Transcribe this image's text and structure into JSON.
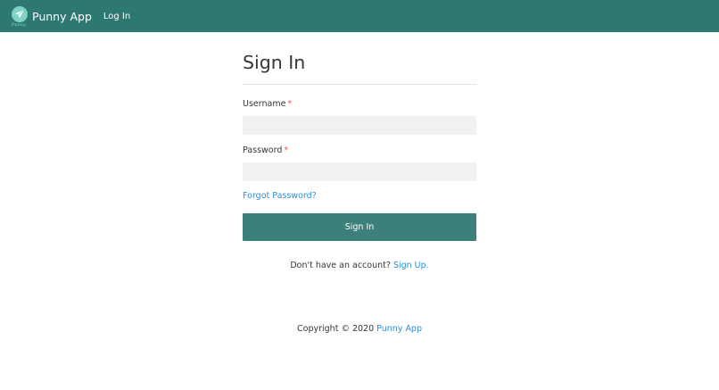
{
  "navbar": {
    "brand_name": "Punny App",
    "logo_script_text": "Punny",
    "login_link": "Log In",
    "logo_icon": "paper-plane-icon"
  },
  "form": {
    "title": "Sign In",
    "username_label": "Username",
    "password_label": "Password",
    "required_marker": "*",
    "username_value": "",
    "password_value": "",
    "forgot_password_link": "Forgot Password?",
    "submit_label": "Sign In",
    "signup_prompt": "Don't have an account?",
    "signup_link": "Sign Up."
  },
  "footer": {
    "copyright_text": "Copyright © 2020",
    "app_link": "Punny App"
  },
  "colors": {
    "navbar": "#2e7872",
    "button": "#3d7f7a",
    "link": "#2d8fd5",
    "required": "#e05a5a",
    "input_bg": "#f1f1f1"
  }
}
